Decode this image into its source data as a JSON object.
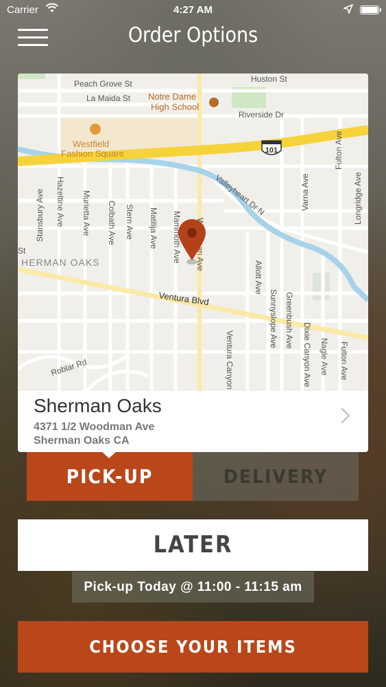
{
  "status_bar": {
    "carrier": "Carrier",
    "time": "4:27 AM"
  },
  "header": {
    "title": "Order Options"
  },
  "map": {
    "labels": {
      "peach_grove": "Peach Grove St",
      "la_maida": "La Maida St",
      "huston": "Huston St",
      "notre_dame_1": "Notre Dame",
      "notre_dame_2": "High School",
      "riverside": "Riverside Dr",
      "hazeltine": "Hazeltine Ave",
      "westfield_1": "Westfield",
      "westfield_2": "Fashion Square",
      "hwy": "101",
      "fulton_top": "Fulton Ave",
      "varna": "Varna Ave",
      "longridge": "Longridge Ave",
      "valleyheart": "Valleyheart Dr N",
      "stansbury": "Stansbury Ave",
      "murietta": "Murietta Ave",
      "colbath": "Colbath Ave",
      "stern": "Stern Ave",
      "matilija": "Matilija Ave",
      "mammoth": "Mammoth Ave",
      "woodman": "Woodman Ave",
      "st": "St",
      "sherman_oaks": "HERMAN OAKS",
      "allott": "Allott Ave",
      "ventura_blvd": "Ventura Blvd",
      "sunnyslope": "Sunnyslope Ave",
      "greenbush": "Greenbush Ave",
      "dixie_canyon": "Dixie Canyon Ave",
      "nagle": "Nagle Ave",
      "fulton_bottom": "Fulton Ave",
      "ventura_canyon": "Ventura Canyon",
      "roblar": "Roblar Rd"
    }
  },
  "location": {
    "name": "Sherman Oaks",
    "address_line1": "4371 1/2 Woodman Ave",
    "address_line2": "Sherman Oaks CA"
  },
  "order_type": {
    "pickup": "PICK-UP",
    "delivery": "DELIVERY",
    "selected": "pickup"
  },
  "timing": {
    "later_label": "LATER",
    "pickup_time": "Pick-up Today @ 11:00 - 11:15 am"
  },
  "cta": {
    "label": "CHOOSE YOUR ITEMS"
  },
  "colors": {
    "accent": "#b9471a",
    "freeway": "#f6d33b",
    "river": "#a6d3ea",
    "pin": "#b5411a"
  }
}
